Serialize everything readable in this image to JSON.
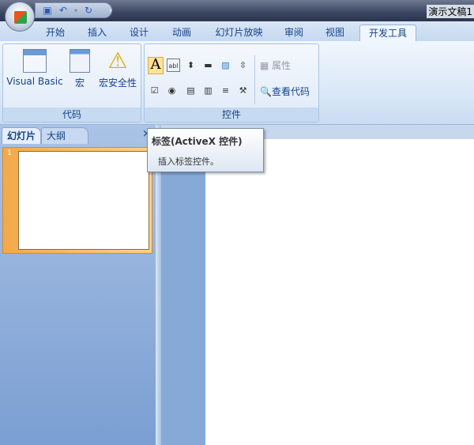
{
  "titlebar": {
    "document_title": "演示文稿1"
  },
  "tabs": [
    "开始",
    "插入",
    "设计",
    "动画",
    "幻灯片放映",
    "审阅",
    "视图",
    "开发工具"
  ],
  "active_tab": "开发工具",
  "ribbon": {
    "code_group": {
      "label": "代码",
      "visual_basic": "Visual Basic",
      "macro": "宏",
      "macro_security": "宏安全性"
    },
    "controls_group": {
      "label": "控件",
      "properties": "属性",
      "view_code": "查看代码"
    }
  },
  "panel": {
    "tabs": [
      "幻灯片",
      "大纲"
    ],
    "close": "×",
    "slide_number": "1"
  },
  "tooltip": {
    "title": "标签(ActiveX 控件)",
    "description": "插入标签控件。"
  }
}
